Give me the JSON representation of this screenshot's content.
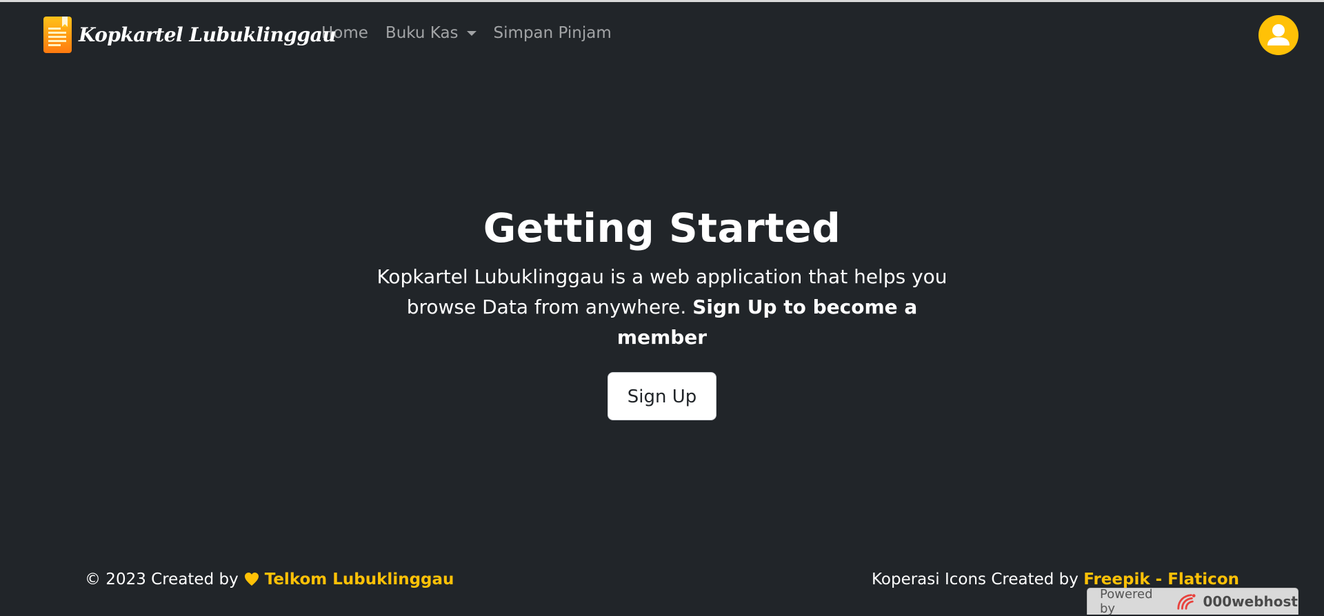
{
  "colors": {
    "background": "#212529",
    "accent": "#ffc107",
    "nav_link": "rgba(255,255,255,0.58)",
    "text": "#ffffff"
  },
  "navbar": {
    "brand_name": "Kopkartel Lubuklinggau",
    "brand_icon": "document-icon",
    "links": [
      {
        "label": "Home",
        "dropdown": false
      },
      {
        "label": "Buku Kas",
        "dropdown": true
      },
      {
        "label": "Simpan Pinjam",
        "dropdown": false
      }
    ],
    "avatar_icon": "user-icon"
  },
  "hero": {
    "title": "Getting Started",
    "lead": "Kopkartel Lubuklinggau is a web application that helps you browse Data from anywhere.",
    "lead_strong": "Sign Up to become a member",
    "button": "Sign Up"
  },
  "footer": {
    "left_prefix": "© 2023 Created by",
    "left_icon": "heart-icon",
    "left_link": "Telkom Lubuklinggau",
    "right_prefix": "Koperasi Icons Created by",
    "right_link": "Freepik - Flaticon"
  },
  "badge": {
    "prefix": "Powered by",
    "host": "000webhost",
    "icon": "000webhost-logo-icon"
  }
}
